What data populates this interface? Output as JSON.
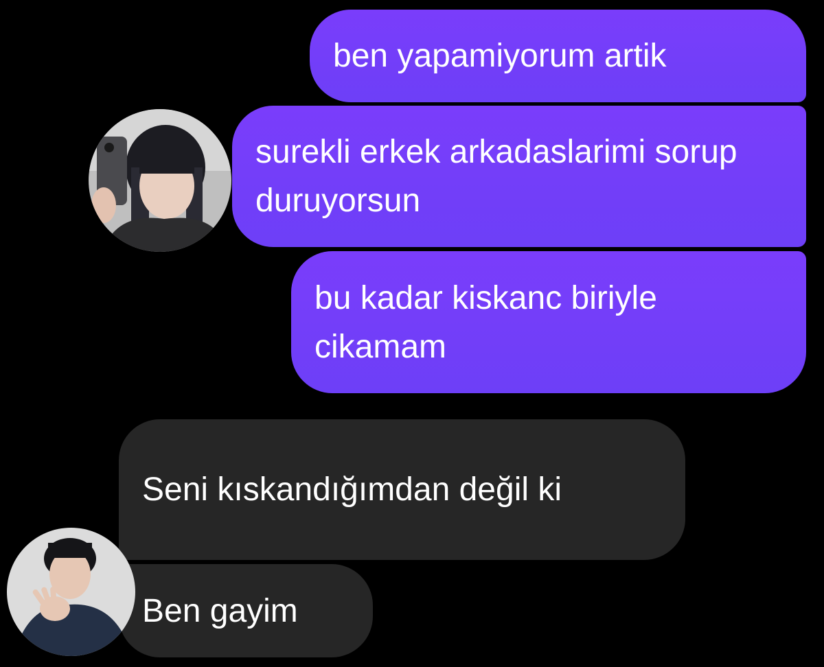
{
  "conversation": {
    "messages": [
      {
        "sender": "me",
        "text": "ben yapamiyorum artik"
      },
      {
        "sender": "me",
        "text": "surekli erkek arkadaslarimi sorup duruyorsun"
      },
      {
        "sender": "me",
        "text": "bu kadar kiskanc biriyle cikamam"
      },
      {
        "sender": "other",
        "text": "Seni kıskandığımdan değil ki"
      },
      {
        "sender": "other",
        "text": "Ben gayim"
      }
    ]
  },
  "colors": {
    "background": "#000000",
    "sent_bubble": "#7a3dfb",
    "received_bubble": "#262626",
    "text": "#ffffff"
  }
}
